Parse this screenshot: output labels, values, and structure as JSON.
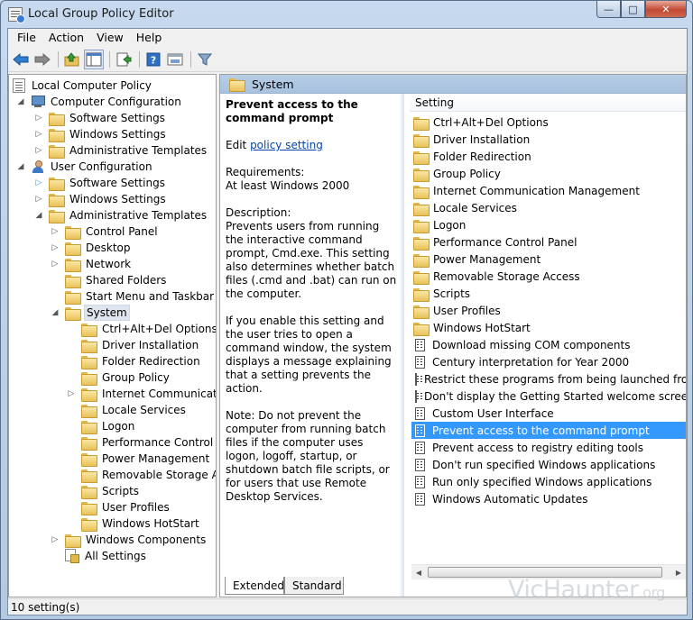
{
  "window": {
    "title": "Local Group Policy Editor"
  },
  "menu": [
    "File",
    "Action",
    "View",
    "Help"
  ],
  "tree": {
    "root": "Local Computer Policy",
    "items": [
      {
        "label": "Computer Configuration",
        "level": 1,
        "icon": "computer",
        "exp": "open"
      },
      {
        "label": "Software Settings",
        "level": 2,
        "icon": "folder",
        "exp": "closed"
      },
      {
        "label": "Windows Settings",
        "level": 2,
        "icon": "folder",
        "exp": "closed"
      },
      {
        "label": "Administrative Templates",
        "level": 2,
        "icon": "folder",
        "exp": "closed"
      },
      {
        "label": "User Configuration",
        "level": 1,
        "icon": "user",
        "exp": "open"
      },
      {
        "label": "Software Settings",
        "level": 2,
        "icon": "folder",
        "exp": "closed-blue"
      },
      {
        "label": "Windows Settings",
        "level": 2,
        "icon": "folder",
        "exp": "closed"
      },
      {
        "label": "Administrative Templates",
        "level": 2,
        "icon": "folder",
        "exp": "open"
      },
      {
        "label": "Control Panel",
        "level": 3,
        "icon": "folder",
        "exp": "closed"
      },
      {
        "label": "Desktop",
        "level": 3,
        "icon": "folder",
        "exp": "closed"
      },
      {
        "label": "Network",
        "level": 3,
        "icon": "folder",
        "exp": "closed"
      },
      {
        "label": "Shared Folders",
        "level": 3,
        "icon": "folder",
        "exp": "none"
      },
      {
        "label": "Start Menu and Taskbar",
        "level": 3,
        "icon": "folder",
        "exp": "none"
      },
      {
        "label": "System",
        "level": 3,
        "icon": "folder",
        "exp": "open",
        "selected": true
      },
      {
        "label": "Ctrl+Alt+Del Options",
        "level": 4,
        "icon": "folder",
        "exp": "none"
      },
      {
        "label": "Driver Installation",
        "level": 4,
        "icon": "folder",
        "exp": "none"
      },
      {
        "label": "Folder Redirection",
        "level": 4,
        "icon": "folder",
        "exp": "none"
      },
      {
        "label": "Group Policy",
        "level": 4,
        "icon": "folder",
        "exp": "none"
      },
      {
        "label": "Internet Communication",
        "level": 4,
        "icon": "folder",
        "exp": "closed"
      },
      {
        "label": "Locale Services",
        "level": 4,
        "icon": "folder",
        "exp": "none"
      },
      {
        "label": "Logon",
        "level": 4,
        "icon": "folder",
        "exp": "none"
      },
      {
        "label": "Performance Control Pa",
        "level": 4,
        "icon": "folder",
        "exp": "none"
      },
      {
        "label": "Power Management",
        "level": 4,
        "icon": "folder",
        "exp": "none"
      },
      {
        "label": "Removable Storage Acc",
        "level": 4,
        "icon": "folder",
        "exp": "none"
      },
      {
        "label": "Scripts",
        "level": 4,
        "icon": "folder",
        "exp": "none"
      },
      {
        "label": "User Profiles",
        "level": 4,
        "icon": "folder",
        "exp": "none"
      },
      {
        "label": "Windows HotStart",
        "level": 4,
        "icon": "folder",
        "exp": "none"
      },
      {
        "label": "Windows Components",
        "level": 3,
        "icon": "folder",
        "exp": "closed"
      },
      {
        "label": "All Settings",
        "level": 3,
        "icon": "settings",
        "exp": "none"
      }
    ]
  },
  "node_header": "System",
  "description": {
    "title": "Prevent access to the command prompt",
    "edit_prefix": "Edit ",
    "edit_link": "policy setting",
    "requirements_label": "Requirements:",
    "requirements_value": "At least Windows 2000",
    "description_label": "Description:",
    "description_text": "Prevents users from running the interactive command prompt, Cmd.exe. This setting also determines whether batch files (.cmd and .bat) can run on the computer.",
    "paragraph2": "If you enable this setting and the user tries to open a command window, the system displays a message explaining that a setting prevents the action.",
    "paragraph3": "Note: Do not prevent the computer from running batch files if the computer uses logon, logoff, startup, or shutdown batch file scripts, or for users that use Remote Desktop Services."
  },
  "list": {
    "column_header": "Setting",
    "items": [
      {
        "label": "Ctrl+Alt+Del Options",
        "type": "folder"
      },
      {
        "label": "Driver Installation",
        "type": "folder"
      },
      {
        "label": "Folder Redirection",
        "type": "folder"
      },
      {
        "label": "Group Policy",
        "type": "folder"
      },
      {
        "label": "Internet Communication Management",
        "type": "folder"
      },
      {
        "label": "Locale Services",
        "type": "folder"
      },
      {
        "label": "Logon",
        "type": "folder"
      },
      {
        "label": "Performance Control Panel",
        "type": "folder"
      },
      {
        "label": "Power Management",
        "type": "folder"
      },
      {
        "label": "Removable Storage Access",
        "type": "folder"
      },
      {
        "label": "Scripts",
        "type": "folder"
      },
      {
        "label": "User Profiles",
        "type": "folder"
      },
      {
        "label": "Windows HotStart",
        "type": "folder"
      },
      {
        "label": "Download missing COM components",
        "type": "setting"
      },
      {
        "label": "Century interpretation for Year 2000",
        "type": "setting"
      },
      {
        "label": "Restrict these programs from being launched from He",
        "type": "setting"
      },
      {
        "label": "Don't display the Getting Started welcome screen at lo",
        "type": "setting"
      },
      {
        "label": "Custom User Interface",
        "type": "setting"
      },
      {
        "label": "Prevent access to the command prompt",
        "type": "setting",
        "selected": true
      },
      {
        "label": "Prevent access to registry editing tools",
        "type": "setting"
      },
      {
        "label": "Don't run specified Windows applications",
        "type": "setting"
      },
      {
        "label": "Run only specified Windows applications",
        "type": "setting"
      },
      {
        "label": "Windows Automatic Updates",
        "type": "setting"
      }
    ]
  },
  "tabs": [
    "Extended",
    "Standard"
  ],
  "status": "10 setting(s)",
  "watermark": {
    "main": "VicHaunter",
    "suffix": ".org"
  }
}
